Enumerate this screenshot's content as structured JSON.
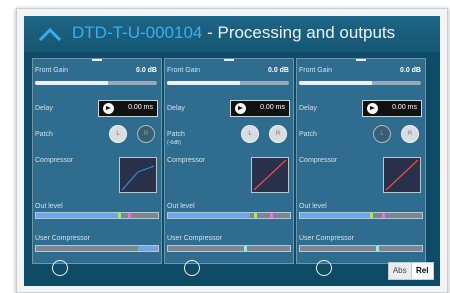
{
  "header": {
    "code": "DTD-T-U-000104",
    "suffix": " - Processing and outputs"
  },
  "labels": {
    "front_gain": "Front Gain",
    "delay": "Delay",
    "patch": "Patch",
    "compressor": "Compressor",
    "out_level": "Out level",
    "user_compressor": "User Compressor"
  },
  "columns": [
    {
      "gain": "0.0 dB",
      "gain_fraction": 0.6,
      "delay": "0.00 ms",
      "patch_sub": "",
      "left_button": "L",
      "right_button": "R",
      "left_active": true,
      "right_active": false
    },
    {
      "gain": "0.0 dB",
      "gain_fraction": 0.6,
      "delay": "0.00 ms",
      "patch_sub": "(-6dB)",
      "left_button": "L",
      "right_button": "R",
      "left_active": true,
      "right_active": true
    },
    {
      "gain": "0.0 dB",
      "gain_fraction": 0.6,
      "delay": "0.00 ms",
      "patch_sub": "",
      "left_button": "L",
      "right_button": "R",
      "left_active": false,
      "right_active": true
    }
  ],
  "toggle": {
    "abs": "Abs",
    "rel": "Rel",
    "selected": "Rel"
  },
  "colors": {
    "accent": "#39aef0",
    "panel": "#0f4a66",
    "column": "#2f6c8e"
  }
}
